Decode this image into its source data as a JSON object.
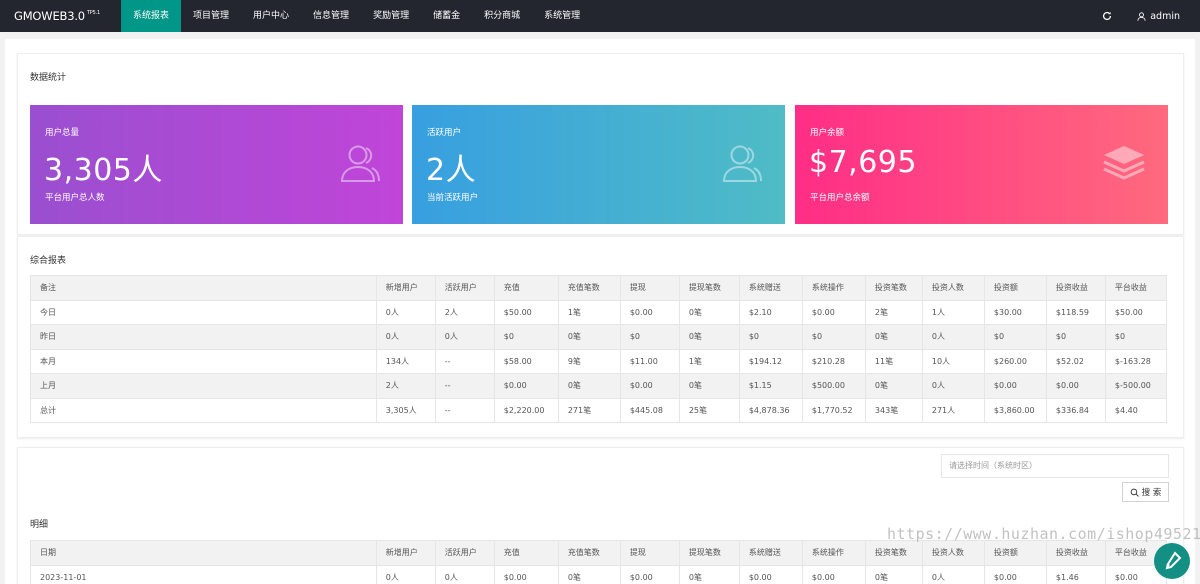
{
  "app": {
    "logo": "GMOWEB3.0",
    "version": "TP5.1"
  },
  "nav": [
    {
      "label": "系统报表",
      "active": true
    },
    {
      "label": "项目管理"
    },
    {
      "label": "用户中心"
    },
    {
      "label": "信息管理"
    },
    {
      "label": "奖励管理"
    },
    {
      "label": "储蓄金"
    },
    {
      "label": "积分商城"
    },
    {
      "label": "系统管理"
    }
  ],
  "header": {
    "user": "admin",
    "refresh_icon": "refresh-icon",
    "user_icon": "user-icon"
  },
  "stats": {
    "title": "数据统计",
    "cards": [
      {
        "label": "用户总量",
        "value": "3,305人",
        "sub": "平台用户总人数",
        "icon": "users-icon",
        "color": "#a94cd6"
      },
      {
        "label": "活跃用户",
        "value": "2人",
        "sub": "当前活跃用户",
        "icon": "users-icon",
        "color": "#3aa6dc"
      },
      {
        "label": "用户余额",
        "value": "$7,695",
        "sub": "平台用户总余额",
        "icon": "layers-icon",
        "color": "#ff3d84"
      }
    ]
  },
  "summary": {
    "title": "综合报表",
    "columns": [
      "备注",
      "新增用户",
      "活跃用户",
      "充值",
      "充值笔数",
      "提现",
      "提现笔数",
      "系统赠送",
      "系统操作",
      "投资笔数",
      "投资人数",
      "投资额",
      "投资收益",
      "平台收益"
    ],
    "rows": [
      [
        "今日",
        "0人",
        "2人",
        "$50.00",
        "1笔",
        "$0.00",
        "0笔",
        "$2.10",
        "$0.00",
        "2笔",
        "1人",
        "$30.00",
        "$118.59",
        "$50.00"
      ],
      [
        "昨日",
        "0人",
        "0人",
        "$0",
        "0笔",
        "$0",
        "0笔",
        "$0",
        "$0",
        "0笔",
        "0人",
        "$0",
        "$0",
        "$0"
      ],
      [
        "本月",
        "134人",
        "--",
        "$58.00",
        "9笔",
        "$11.00",
        "1笔",
        "$194.12",
        "$210.28",
        "11笔",
        "10人",
        "$260.00",
        "$52.02",
        "$-163.28"
      ],
      [
        "上月",
        "2人",
        "--",
        "$0.00",
        "0笔",
        "$0.00",
        "0笔",
        "$1.15",
        "$500.00",
        "0笔",
        "0人",
        "$0.00",
        "$0.00",
        "$-500.00"
      ],
      [
        "总计",
        "3,305人",
        "--",
        "$2,220.00",
        "271笔",
        "$445.08",
        "25笔",
        "$4,878.36",
        "$1,770.52",
        "343笔",
        "271人",
        "$3,860.00",
        "$336.84",
        "$4.40"
      ]
    ]
  },
  "detail": {
    "title": "明细",
    "date_placeholder": "请选择时间（系统时区）",
    "search_label": "搜 索",
    "columns": [
      "日期",
      "新增用户",
      "活跃用户",
      "充值",
      "充值笔数",
      "提现",
      "提现笔数",
      "系统赠送",
      "系统操作",
      "投资笔数",
      "投资人数",
      "投资额",
      "投资收益",
      "平台收益"
    ],
    "rows": [
      [
        "2023-11-01",
        "0人",
        "0人",
        "$0.00",
        "0笔",
        "$0.00",
        "0笔",
        "$0.00",
        "$0.00",
        "0笔",
        "0人",
        "$0.00",
        "$1.46",
        "$0.00"
      ]
    ]
  },
  "watermark": "https://www.huzhan.com/ishop49521"
}
